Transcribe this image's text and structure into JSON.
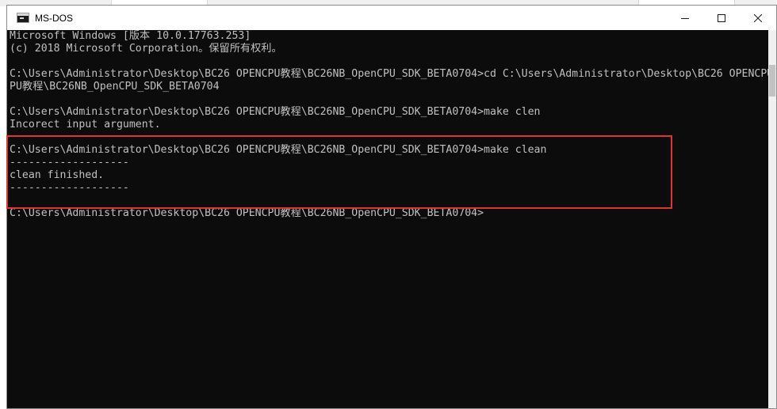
{
  "window": {
    "title": "MS-DOS",
    "app_icon": "console-icon",
    "controls": {
      "minimize_icon": "minimize-icon",
      "maximize_icon": "maximize-icon",
      "close_icon": "close-icon"
    }
  },
  "console": {
    "lines": [
      "Microsoft Windows [版本 10.0.17763.253]",
      "(c) 2018 Microsoft Corporation。保留所有权利。",
      "",
      "C:\\Users\\Administrator\\Desktop\\BC26 OPENCPU教程\\BC26NB_OpenCPU_SDK_BETA0704>cd C:\\Users\\Administrator\\Desktop\\BC26 OPENCPU教程\\BC26NB_OpenCPU_SDK_BETA0704",
      "PU教程\\BC26NB_OpenCPU_SDK_BETA0704",
      "",
      "C:\\Users\\Administrator\\Desktop\\BC26 OPENCPU教程\\BC26NB_OpenCPU_SDK_BETA0704>make clen",
      "Incorect input argument.",
      "",
      "C:\\Users\\Administrator\\Desktop\\BC26 OPENCPU教程\\BC26NB_OpenCPU_SDK_BETA0704>make clean",
      "-------------------",
      "clean finished.",
      "-------------------",
      "",
      "C:\\Users\\Administrator\\Desktop\\BC26 OPENCPU教程\\BC26NB_OpenCPU_SDK_BETA0704>"
    ]
  },
  "colors": {
    "console_bg": "#0c0c0c",
    "console_fg": "#c0c0c0",
    "highlight_border": "#e23232",
    "titlebar_bg": "#ffffff"
  }
}
